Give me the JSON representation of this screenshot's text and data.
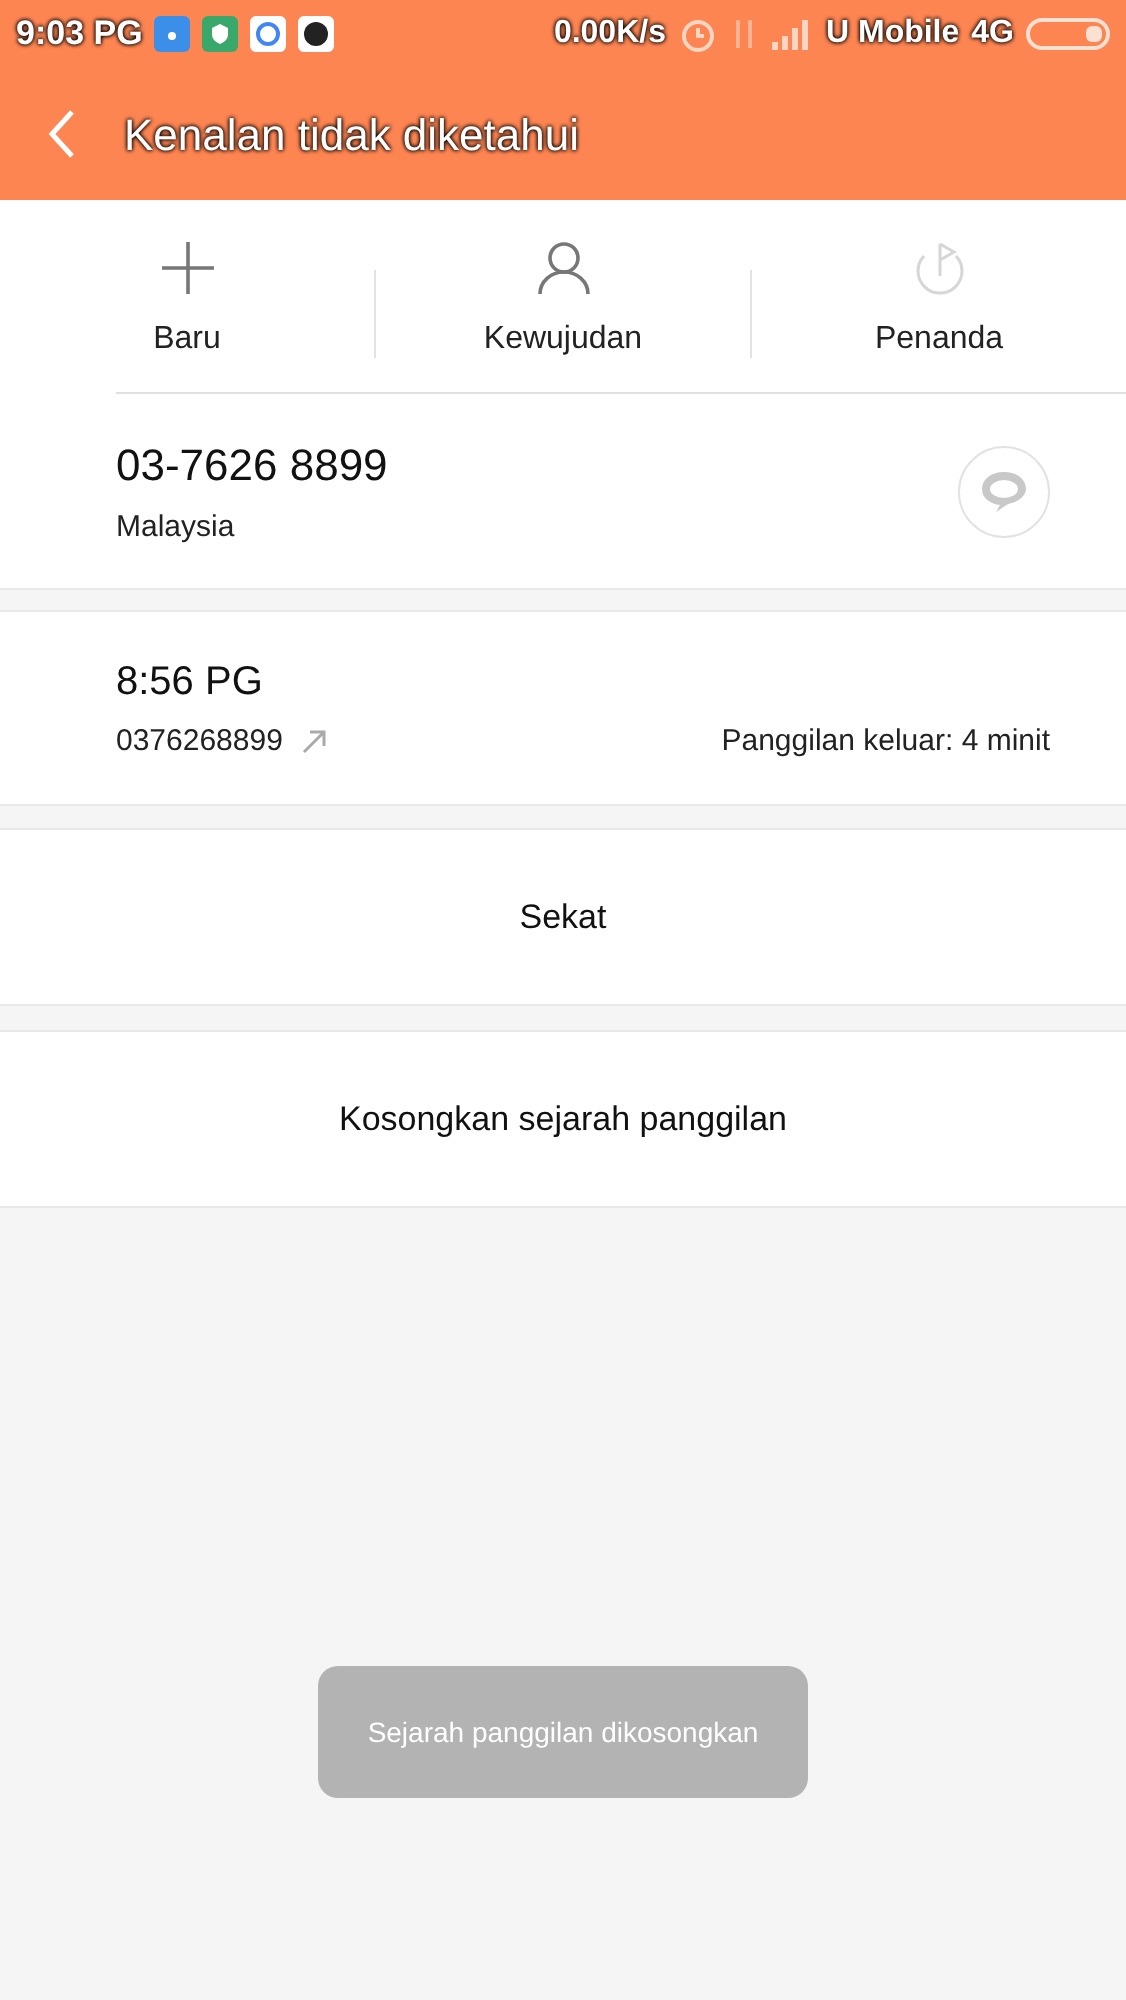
{
  "status_bar": {
    "time": "9:03 PG",
    "speed": "0.00K/s",
    "carrier": "U Mobile",
    "network": "4G"
  },
  "header": {
    "title": "Kenalan tidak diketahui"
  },
  "actions": [
    {
      "kind": "new",
      "label": "Baru",
      "disabled": false
    },
    {
      "kind": "contact",
      "label": "Kewujudan",
      "disabled": false
    },
    {
      "kind": "flag",
      "label": "Penanda",
      "disabled": true
    }
  ],
  "contact": {
    "number": "03-7626 8899",
    "location": "Malaysia"
  },
  "call_log": [
    {
      "time": "8:56 PG",
      "number": "0376268899",
      "kind": "outgoing",
      "detail": "Panggilan keluar: 4 minit"
    }
  ],
  "buttons": [
    "Sekat",
    "Kosongkan sejarah panggilan"
  ],
  "toast": "Sejarah panggilan dikosongkan"
}
